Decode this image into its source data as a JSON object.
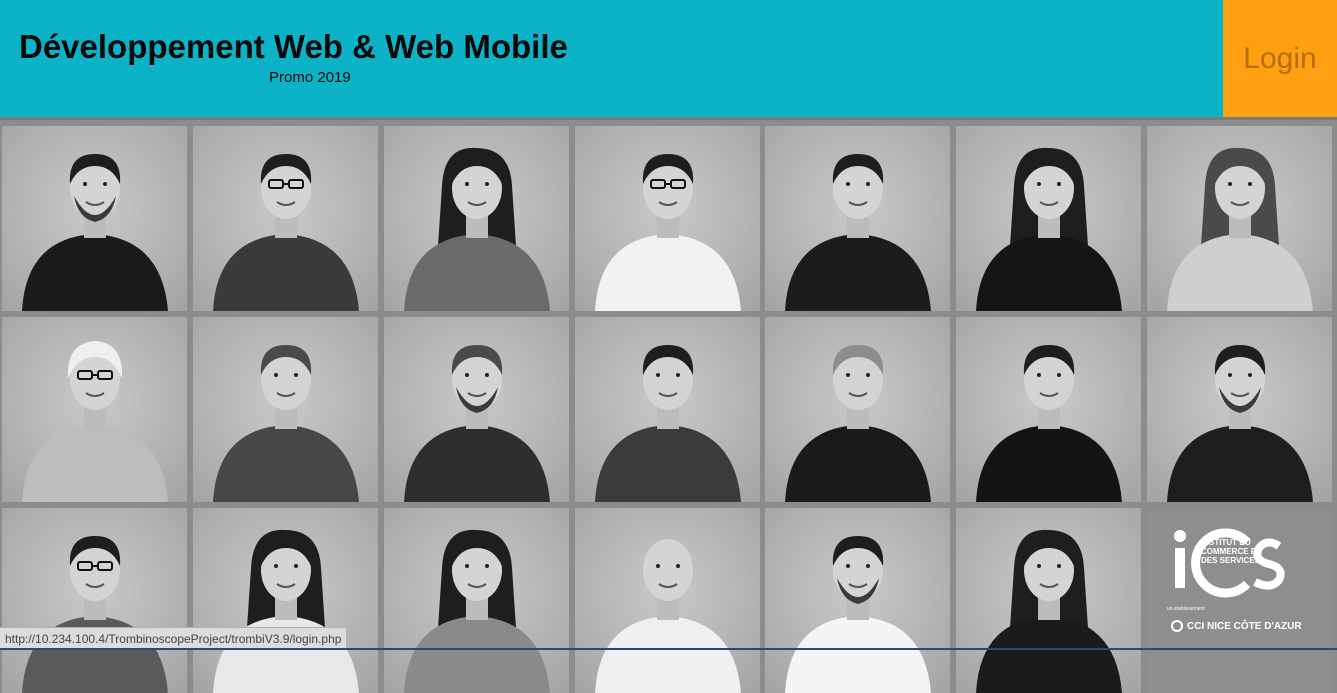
{
  "header": {
    "title": "Développement Web & Web Mobile",
    "subtitle": "Promo 2019",
    "login_label": "Login"
  },
  "colors": {
    "header_bg": "#0cb3c6",
    "login_bg": "#ffa012",
    "login_text": "#b56f08",
    "grid_bg": "#8c8c8c"
  },
  "students": [
    {
      "name": "student-photo-1",
      "hair": "dark",
      "shirt": "#1a1a1a",
      "beard": true
    },
    {
      "name": "student-photo-2",
      "hair": "dark",
      "shirt": "#3a3a3a",
      "glasses": true
    },
    {
      "name": "student-photo-3",
      "hair": "dark",
      "shirt": "#6a6a6a",
      "long": true
    },
    {
      "name": "student-photo-4",
      "hair": "dark",
      "shirt": "#f2f2f2",
      "glasses": true
    },
    {
      "name": "student-photo-5",
      "hair": "dark",
      "shirt": "#1c1c1c"
    },
    {
      "name": "student-photo-6",
      "hair": "dark",
      "shirt": "#151515",
      "long": true
    },
    {
      "name": "student-photo-7",
      "hair": "mid",
      "shirt": "#cfcfcf",
      "long": true
    },
    {
      "name": "student-photo-8",
      "hair": "light",
      "shirt": "#bdbdbd",
      "glasses": true,
      "headscarf": true
    },
    {
      "name": "student-photo-9",
      "hair": "mid",
      "shirt": "#474747"
    },
    {
      "name": "student-photo-10",
      "hair": "mid",
      "shirt": "#2e2e2e",
      "beard": true
    },
    {
      "name": "student-photo-11",
      "hair": "dark",
      "shirt": "#3b3b3b"
    },
    {
      "name": "student-photo-12",
      "hair": "light",
      "shirt": "#1a1a1a"
    },
    {
      "name": "student-photo-13",
      "hair": "dark",
      "shirt": "#141414"
    },
    {
      "name": "student-photo-14",
      "hair": "dark",
      "shirt": "#1e1e1e",
      "beard": true
    },
    {
      "name": "student-photo-15",
      "hair": "dark",
      "shirt": "#5a5a5a",
      "glasses": true
    },
    {
      "name": "student-photo-16",
      "hair": "dark",
      "shirt": "#e8e8e8",
      "long": true
    },
    {
      "name": "student-photo-17",
      "hair": "dark",
      "shirt": "#8a8a8a",
      "long": true
    },
    {
      "name": "student-photo-18",
      "hair": "bald",
      "shirt": "#f0f0f0"
    },
    {
      "name": "student-photo-19",
      "hair": "dark",
      "shirt": "#f5f5f5",
      "beard": true
    },
    {
      "name": "student-photo-20",
      "hair": "dark",
      "shirt": "#1b1b1b",
      "long": true
    }
  ],
  "logo": {
    "brand": "iCS",
    "line1": "INSTITUT DU",
    "line2": "COMMERCE ET",
    "line3": "DES SERVICES",
    "small": "un établissement",
    "cci": "CCI NICE CÔTE D'AZUR"
  },
  "status_bar": {
    "url": "http://10.234.100.4/TrombinoscopeProject/trombiV3.9/login.php"
  }
}
